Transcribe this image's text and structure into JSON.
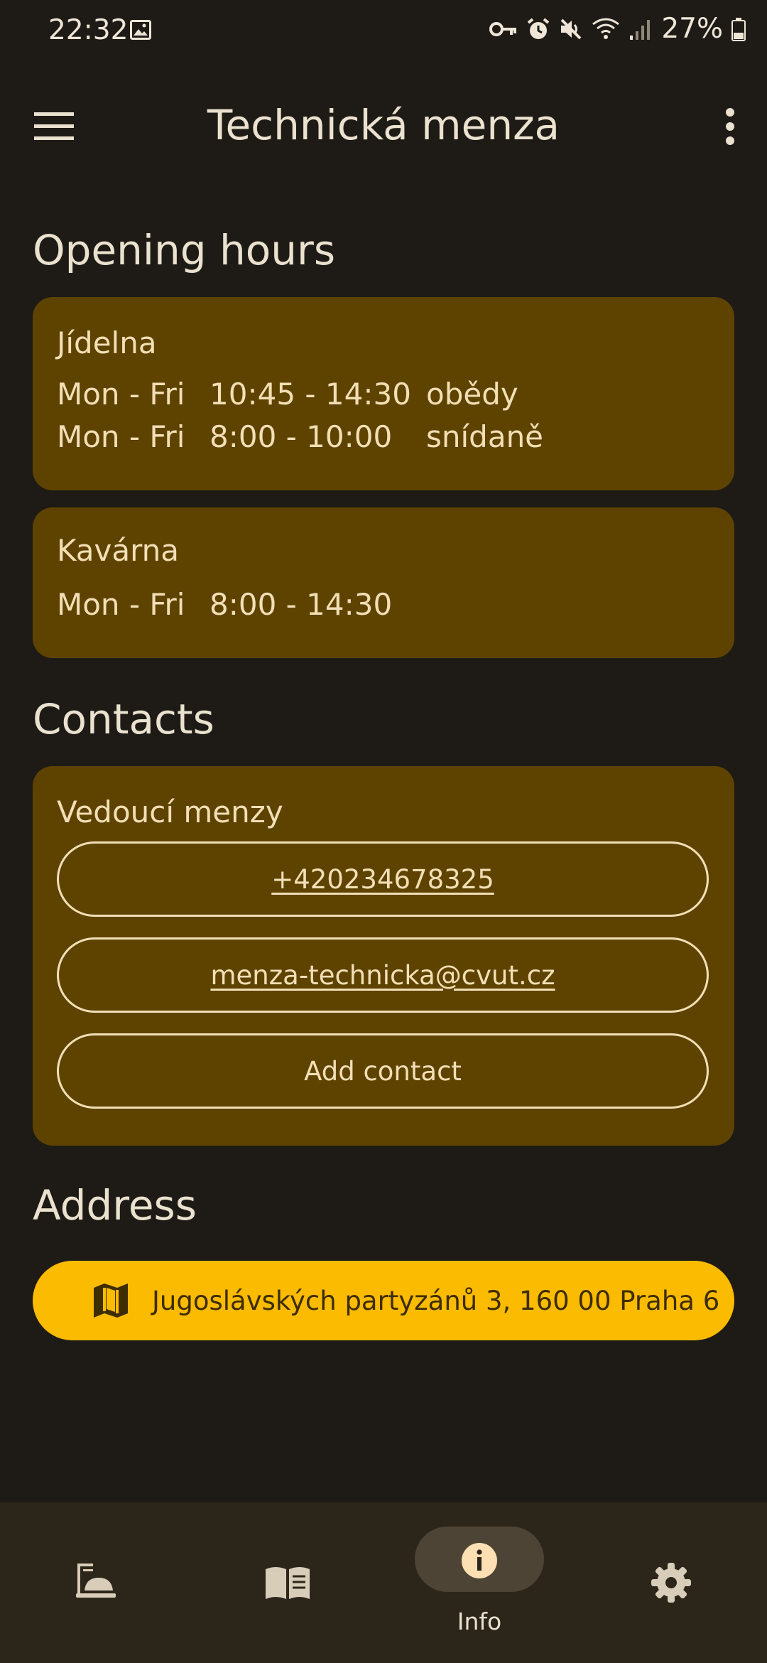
{
  "status": {
    "time": "22:32",
    "battery": "27%"
  },
  "appbar": {
    "title": "Technická menza"
  },
  "opening_hours": {
    "heading": "Opening hours",
    "cards": [
      {
        "name": "Jídelna",
        "rows": [
          {
            "days": "Mon - Fri",
            "time": "10:45 - 14:30",
            "note": "obědy"
          },
          {
            "days": "Mon - Fri",
            "time": "8:00 - 10:00",
            "note": "snídaně"
          }
        ]
      },
      {
        "name": "Kavárna",
        "rows": [
          {
            "days": "Mon - Fri",
            "time": "8:00 - 14:30",
            "note": ""
          }
        ]
      }
    ]
  },
  "contacts": {
    "heading": "Contacts",
    "card_title": "Vedoucí menzy",
    "phone": "+420234678325",
    "email": "menza-technicka@cvut.cz",
    "add_label": "Add contact"
  },
  "address": {
    "heading": "Address",
    "text": "Jugoslávských partyzánů 3, 160 00 Praha 6"
  },
  "nav": {
    "items": [
      {
        "icon": "cafeteria-icon",
        "label": ""
      },
      {
        "icon": "menu-book-icon",
        "label": ""
      },
      {
        "icon": "info-icon",
        "label": "Info",
        "selected": true
      },
      {
        "icon": "settings-icon",
        "label": ""
      }
    ]
  },
  "colors": {
    "background": "#1e1b16",
    "card": "#5e4300",
    "accent": "#fbbb00",
    "navbar": "#2c261a"
  }
}
